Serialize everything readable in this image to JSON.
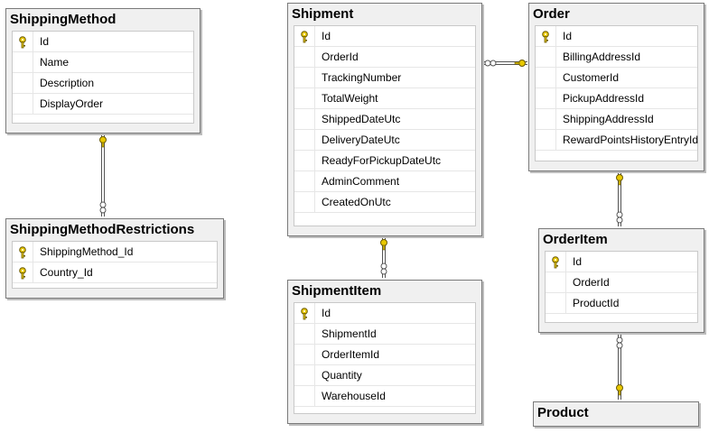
{
  "tables": [
    {
      "id": "shippingmethod",
      "title": "ShippingMethod",
      "columns": [
        {
          "name": "Id",
          "pk": true
        },
        {
          "name": "Name",
          "pk": false
        },
        {
          "name": "Description",
          "pk": false
        },
        {
          "name": "DisplayOrder",
          "pk": false
        }
      ]
    },
    {
      "id": "shippingmethodrestrictions",
      "title": "ShippingMethodRestrictions",
      "columns": [
        {
          "name": "ShippingMethod_Id",
          "pk": true
        },
        {
          "name": "Country_Id",
          "pk": true
        }
      ]
    },
    {
      "id": "shipment",
      "title": "Shipment",
      "columns": [
        {
          "name": "Id",
          "pk": true
        },
        {
          "name": "OrderId",
          "pk": false
        },
        {
          "name": "TrackingNumber",
          "pk": false
        },
        {
          "name": "TotalWeight",
          "pk": false
        },
        {
          "name": "ShippedDateUtc",
          "pk": false
        },
        {
          "name": "DeliveryDateUtc",
          "pk": false
        },
        {
          "name": "ReadyForPickupDateUtc",
          "pk": false
        },
        {
          "name": "AdminComment",
          "pk": false
        },
        {
          "name": "CreatedOnUtc",
          "pk": false
        }
      ]
    },
    {
      "id": "shipmentitem",
      "title": "ShipmentItem",
      "columns": [
        {
          "name": "Id",
          "pk": true
        },
        {
          "name": "ShipmentId",
          "pk": false
        },
        {
          "name": "OrderItemId",
          "pk": false
        },
        {
          "name": "Quantity",
          "pk": false
        },
        {
          "name": "WarehouseId",
          "pk": false
        }
      ]
    },
    {
      "id": "order",
      "title": "Order",
      "columns": [
        {
          "name": "Id",
          "pk": true
        },
        {
          "name": "BillingAddressId",
          "pk": false
        },
        {
          "name": "CustomerId",
          "pk": false
        },
        {
          "name": "PickupAddressId",
          "pk": false
        },
        {
          "name": "ShippingAddressId",
          "pk": false
        },
        {
          "name": "RewardPointsHistoryEntryId",
          "pk": false
        }
      ]
    },
    {
      "id": "orderitem",
      "title": "OrderItem",
      "columns": [
        {
          "name": "Id",
          "pk": true
        },
        {
          "name": "OrderId",
          "pk": false
        },
        {
          "name": "ProductId",
          "pk": false
        }
      ]
    },
    {
      "id": "product",
      "title": "Product",
      "columns": []
    }
  ],
  "relationships": [
    {
      "one": "shippingmethod",
      "many": "shippingmethodrestrictions"
    },
    {
      "one": "order",
      "many": "shipment"
    },
    {
      "one": "shipment",
      "many": "shipmentitem"
    },
    {
      "one": "order",
      "many": "orderitem"
    },
    {
      "one": "product",
      "many": "orderitem"
    }
  ],
  "colors": {
    "key_gold": "#e8c800",
    "line": "#555555",
    "title_bg": "#f0f0f0"
  }
}
